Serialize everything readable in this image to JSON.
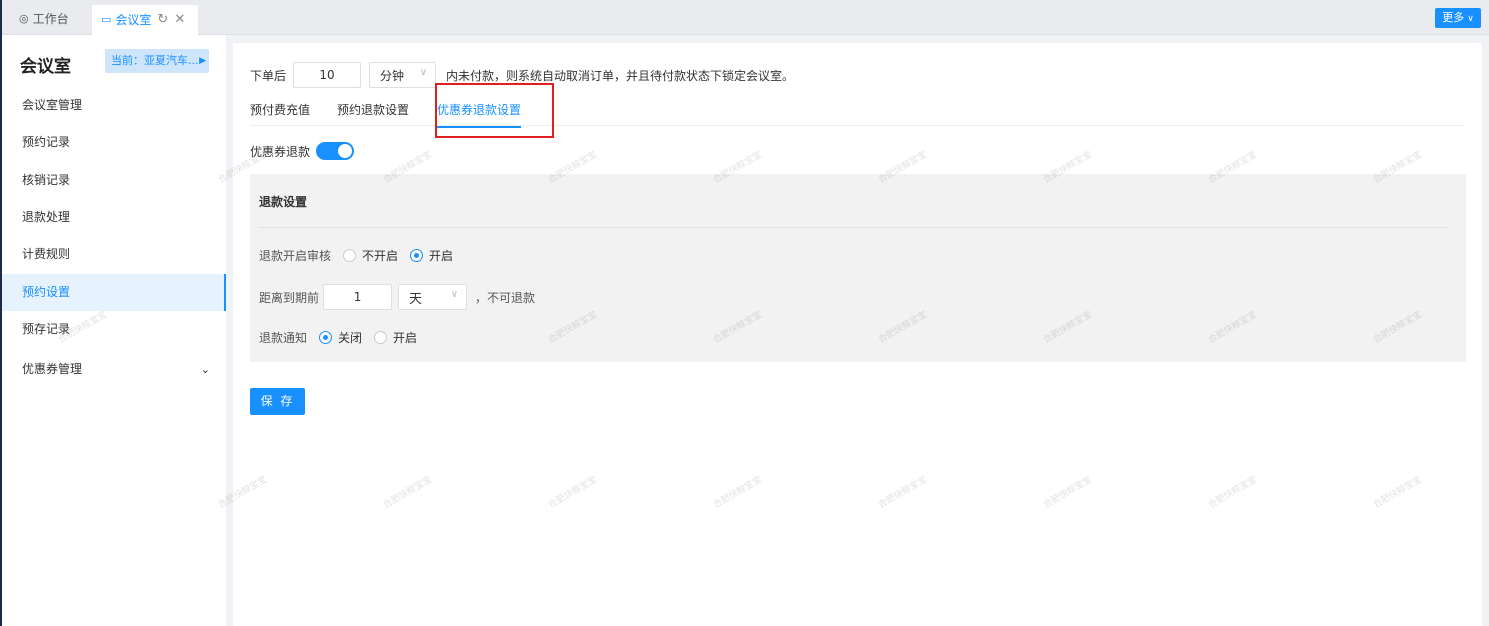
{
  "tabbar": {
    "tabs": [
      {
        "label": "工作台",
        "icon": "dashboard-icon"
      },
      {
        "label": "会议室",
        "icon": "monitor-icon"
      }
    ],
    "more_label": "更多"
  },
  "sidebar": {
    "title": "会议室",
    "current_label": "当前：亚夏汽车...",
    "items": [
      {
        "label": "会议室管理"
      },
      {
        "label": "预约记录"
      },
      {
        "label": "核销记录"
      },
      {
        "label": "退款处理"
      },
      {
        "label": "计费规则"
      },
      {
        "label": "预约设置",
        "active": true
      },
      {
        "label": "预存记录"
      },
      {
        "label": "优惠券管理",
        "has_submenu": true
      }
    ]
  },
  "main": {
    "order_prefix": "下单后",
    "order_minutes": "10",
    "order_unit": "分钟",
    "order_suffix": "内未付款，则系统自动取消订单，并且待付款状态下锁定会议室。",
    "tabs": [
      {
        "label": "预付费充值"
      },
      {
        "label": "预约退款设置"
      },
      {
        "label": "优惠券退款设置",
        "active": true
      }
    ],
    "coupon_refund_label": "优惠券退款",
    "coupon_refund_enabled": true,
    "panel": {
      "title": "退款设置",
      "audit_label": "退款开启审核",
      "audit_options": [
        "不开启",
        "开启"
      ],
      "audit_selected": "开启",
      "deadline_label": "距离到期前",
      "deadline_value": "1",
      "deadline_unit": "天",
      "deadline_suffix": "，不可退款",
      "notify_label": "退款通知",
      "notify_options": [
        "关闭",
        "开启"
      ],
      "notify_selected": "关闭"
    },
    "save_label": "保 存"
  },
  "watermark": "合肥快鲸宝宝",
  "colors": {
    "accent": "#1890ff",
    "highlight": "#e02020"
  }
}
